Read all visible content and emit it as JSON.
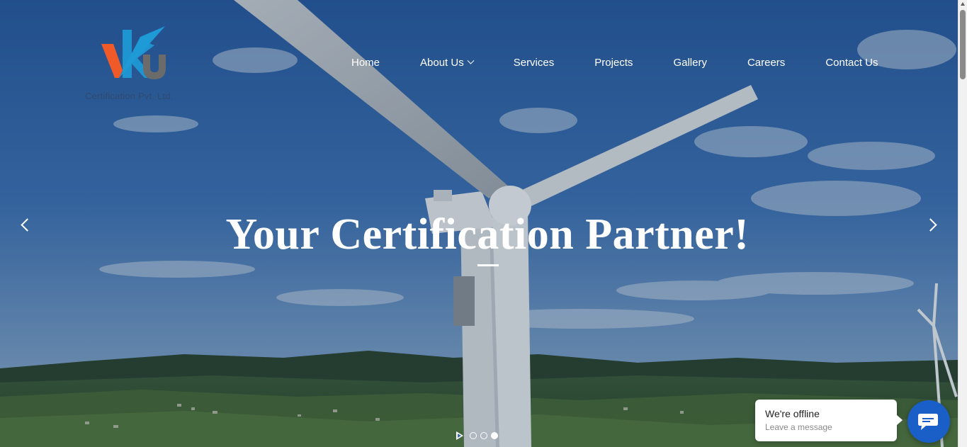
{
  "logo": {
    "mark_letters": "VKU",
    "tagline": "Certification Pvt. Ltd.",
    "colors": {
      "orange": "#f05a28",
      "blue": "#1e9bd7",
      "gray": "#6b6b6b"
    }
  },
  "nav": {
    "items": [
      {
        "label": "Home",
        "has_dropdown": false
      },
      {
        "label": "About Us",
        "has_dropdown": true
      },
      {
        "label": "Services",
        "has_dropdown": false
      },
      {
        "label": "Projects",
        "has_dropdown": false
      },
      {
        "label": "Gallery",
        "has_dropdown": false
      },
      {
        "label": "Careers",
        "has_dropdown": false
      },
      {
        "label": "Contact Us",
        "has_dropdown": false
      }
    ]
  },
  "slider": {
    "headline": "Your Certification Partner!",
    "prev_icon": "chevron-left-icon",
    "next_icon": "chevron-right-icon",
    "slide_count": 3,
    "active_slide": 3,
    "autoplay_icon": "play-icon"
  },
  "chat": {
    "status_title": "We're offline",
    "status_sub": "Leave a message",
    "button_icon": "chat-icon",
    "accent": "#1a5fc8"
  }
}
